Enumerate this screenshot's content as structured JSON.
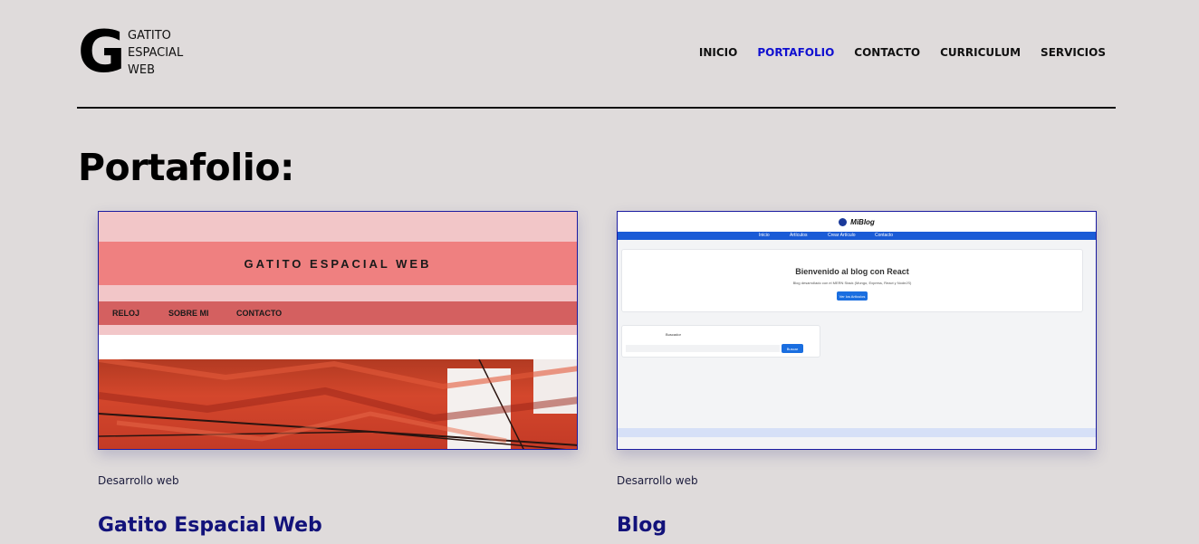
{
  "brand": {
    "letter": "G",
    "line1": "GATITO",
    "line2": "ESPACIAL",
    "line3": "WEB"
  },
  "nav": {
    "items": [
      {
        "label": "INICIO",
        "active": false
      },
      {
        "label": "PORTAFOLIO",
        "active": true
      },
      {
        "label": "CONTACTO",
        "active": false
      },
      {
        "label": "CURRICULUM",
        "active": false
      },
      {
        "label": "SERVICIOS",
        "active": false
      }
    ],
    "active_color": "#1010d0"
  },
  "page": {
    "title": "Portafolio:"
  },
  "projects": [
    {
      "category": "Desarrollo web",
      "title": "Gatito Espacial Web",
      "preview": {
        "banner": "GATITO ESPACIAL WEB",
        "nav": [
          "RELOJ",
          "SOBRE MI",
          "CONTACTO"
        ]
      }
    },
    {
      "category": "Desarrollo web",
      "title": "Blog",
      "preview": {
        "logo": "MiBlog",
        "nav": [
          "Inicio",
          "Artículos",
          "Crear Artículo",
          "Contacto"
        ],
        "hero_title": "Bienvenido al blog con React",
        "hero_sub": "Blog desarrollado con el MERN Stack (Mongo, Express, React y NodeJS)",
        "hero_button": "Ver los Artículos",
        "search_label": "Buscador",
        "search_button": "Buscar"
      }
    }
  ],
  "colors": {
    "background": "#dfdbdb",
    "card_title": "#12127a"
  }
}
